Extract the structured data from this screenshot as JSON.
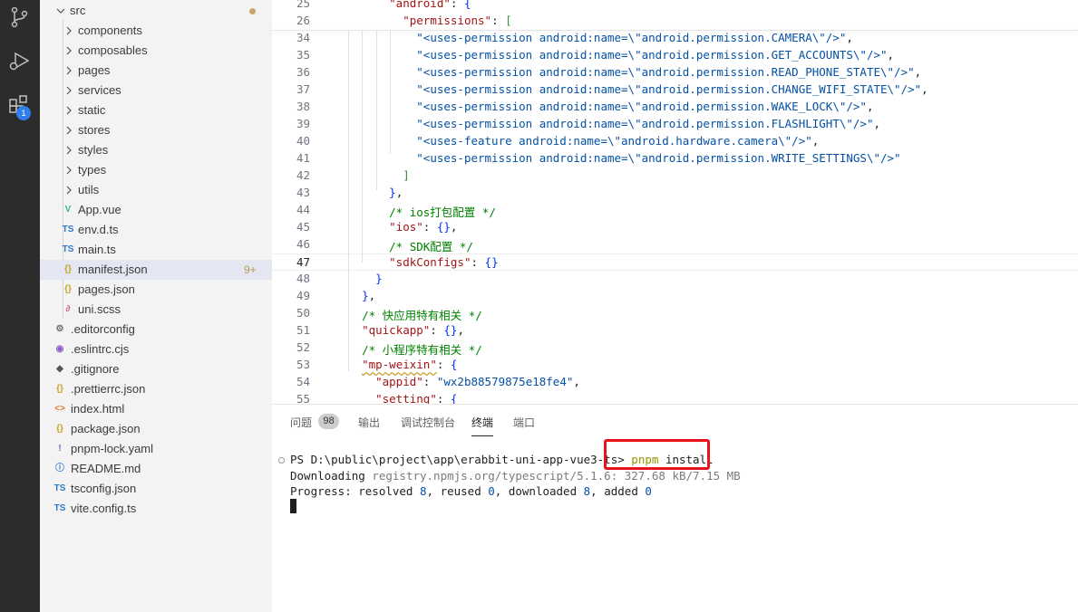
{
  "activity_bar": {
    "extensions_badge": "1",
    "accent_color": "#2f80ed"
  },
  "explorer": {
    "folder": "src",
    "items": [
      {
        "label": "components",
        "kind": "folder"
      },
      {
        "label": "composables",
        "kind": "folder"
      },
      {
        "label": "pages",
        "kind": "folder"
      },
      {
        "label": "services",
        "kind": "folder"
      },
      {
        "label": "static",
        "kind": "folder"
      },
      {
        "label": "stores",
        "kind": "folder"
      },
      {
        "label": "styles",
        "kind": "folder"
      },
      {
        "label": "types",
        "kind": "folder"
      },
      {
        "label": "utils",
        "kind": "folder"
      },
      {
        "label": "App.vue",
        "kind": "vue",
        "icon": "V"
      },
      {
        "label": "env.d.ts",
        "kind": "ts",
        "icon": "TS"
      },
      {
        "label": "main.ts",
        "kind": "ts",
        "icon": "TS"
      },
      {
        "label": "manifest.json",
        "kind": "json",
        "icon": "{}",
        "problems": "9+"
      },
      {
        "label": "pages.json",
        "kind": "json",
        "icon": "{}"
      },
      {
        "label": "uni.scss",
        "kind": "scss",
        "icon": "∂"
      }
    ],
    "root_items": [
      {
        "label": ".editorconfig",
        "icon": "⚙"
      },
      {
        "label": ".eslintrc.cjs",
        "icon": "◉"
      },
      {
        "label": ".gitignore",
        "icon": "◆"
      },
      {
        "label": ".prettierrc.json",
        "icon": "{}"
      },
      {
        "label": "index.html",
        "icon": "<>"
      },
      {
        "label": "package.json",
        "icon": "{}"
      },
      {
        "label": "pnpm-lock.yaml",
        "icon": "!"
      },
      {
        "label": "README.md",
        "icon": "ⓘ"
      },
      {
        "label": "tsconfig.json",
        "icon": "TS"
      },
      {
        "label": "vite.config.ts",
        "icon": "TS"
      }
    ]
  },
  "editor": {
    "lines": [
      {
        "n": "25",
        "text": "      \"android\": {"
      },
      {
        "n": "26",
        "text": "        \"permissions\": ["
      },
      {
        "n": "34",
        "text": "          \"<uses-permission android:name=\\\"android.permission.CAMERA\\\"/>\","
      },
      {
        "n": "35",
        "text": "          \"<uses-permission android:name=\\\"android.permission.GET_ACCOUNTS\\\"/>\","
      },
      {
        "n": "36",
        "text": "          \"<uses-permission android:name=\\\"android.permission.READ_PHONE_STATE\\\"/>\","
      },
      {
        "n": "37",
        "text": "          \"<uses-permission android:name=\\\"android.permission.CHANGE_WIFI_STATE\\\"/>\","
      },
      {
        "n": "38",
        "text": "          \"<uses-permission android:name=\\\"android.permission.WAKE_LOCK\\\"/>\","
      },
      {
        "n": "39",
        "text": "          \"<uses-permission android:name=\\\"android.permission.FLASHLIGHT\\\"/>\","
      },
      {
        "n": "40",
        "text": "          \"<uses-feature android:name=\\\"android.hardware.camera\\\"/>\","
      },
      {
        "n": "41",
        "text": "          \"<uses-permission android:name=\\\"android.permission.WRITE_SETTINGS\\\"/>\""
      },
      {
        "n": "42",
        "text": "        ]"
      },
      {
        "n": "43",
        "text": "      },"
      },
      {
        "n": "44",
        "text": "      /* ios打包配置 */"
      },
      {
        "n": "45",
        "text": "      \"ios\": {},"
      },
      {
        "n": "46",
        "text": "      /* SDK配置 */"
      },
      {
        "n": "47",
        "text": "      \"sdkConfigs\": {}"
      },
      {
        "n": "48",
        "text": "    }"
      },
      {
        "n": "49",
        "text": "  },"
      },
      {
        "n": "50",
        "text": "  /* 快应用特有相关 */"
      },
      {
        "n": "51",
        "text": "  \"quickapp\": {},"
      },
      {
        "n": "52",
        "text": "  /* 小程序特有相关 */"
      },
      {
        "n": "53",
        "text": "  \"mp-weixin\": {"
      },
      {
        "n": "54",
        "text": "    \"appid\": \"wx2b88579875e18fe4\","
      },
      {
        "n": "55",
        "text": "    \"setting\": {"
      }
    ],
    "current_line": "47"
  },
  "panel": {
    "tabs": [
      {
        "label": "问题",
        "badge": "98"
      },
      {
        "label": "输出"
      },
      {
        "label": "调试控制台"
      },
      {
        "label": "终端",
        "active": true
      },
      {
        "label": "端口"
      }
    ],
    "terminal": {
      "prompt": "PS D:\\public\\project\\app\\erabbit-uni-app-vue3-ts>",
      "command_bin": "pnpm",
      "command_arg": "install",
      "line2_prefix": "Downloading ",
      "line2_url": "registry.npmjs.org/typescript/5.1.6: 327.68 kB/7.15 MB",
      "line3": {
        "prefix": "Progress: resolved ",
        "resolved": "8",
        "reused_label": ", reused ",
        "reused": "0",
        "downloaded_label": ", downloaded ",
        "downloaded": "8",
        "added_label": ", added ",
        "added": "0"
      },
      "highlight_color": "#e8141b"
    }
  }
}
